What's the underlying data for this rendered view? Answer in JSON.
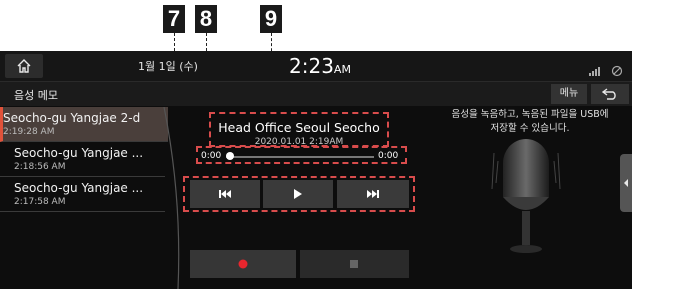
{
  "callouts": [
    "7",
    "8",
    "9"
  ],
  "status_bar": {
    "date": "1월 1일 (수)",
    "time": "2:23",
    "ampm": "AM"
  },
  "header": {
    "title": "음성 메모",
    "menu_label": "메뉴"
  },
  "recordings": [
    {
      "title": "Seocho-gu Yangjae 2-d",
      "time": "2:19:28 AM",
      "selected": true
    },
    {
      "title": "Seocho-gu Yangjae ...",
      "time": "2:18:56 AM",
      "selected": false
    },
    {
      "title": "Seocho-gu Yangjae ...",
      "time": "2:17:58 AM",
      "selected": false
    }
  ],
  "player": {
    "title": "Head Office   Seoul Seocho",
    "date": "2020.01.01 2:19AM",
    "elapsed": "0:00",
    "duration": "0:00",
    "progress": 0
  },
  "controls": {
    "previous_icon": "skip-previous-icon",
    "play_icon": "play-icon",
    "next_icon": "skip-next-icon",
    "record_icon": "record-icon",
    "stop_icon": "stop-icon"
  },
  "hint": {
    "line1": "음성을 녹음하고, 녹음된 파일을 USB에",
    "line2": "저장할 수 있습니다."
  },
  "colors": {
    "accent": "#e0523a",
    "record": "#e8262e",
    "callout_box": "#d84c4c"
  }
}
